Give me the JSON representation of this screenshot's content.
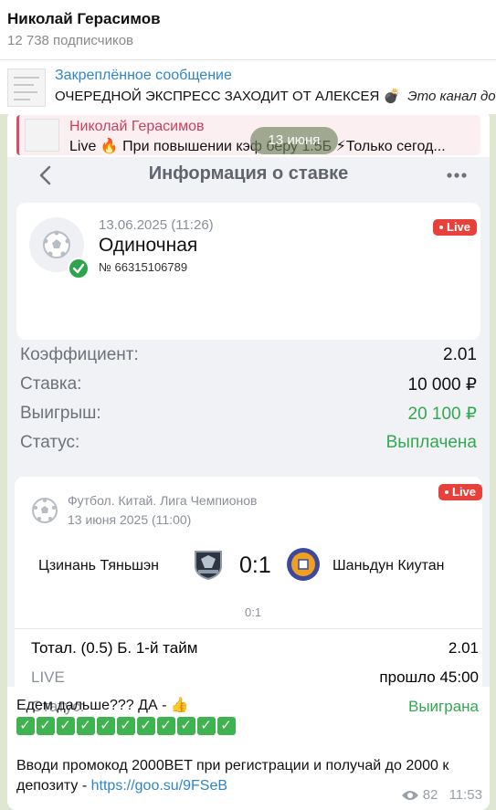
{
  "header": {
    "channel_name": "Николай Герасимов",
    "subscribers": "12 738 подписчиков"
  },
  "pinned": {
    "title": "Закреплённое сообщение",
    "text": "ОЧЕРЕДНОЙ ЭКСПРЕСС ЗАХОДИТ ОТ АЛЕКСЕЯ 💣",
    "text_italic": "Это канал до"
  },
  "reply": {
    "author": "Николай Герасимов",
    "text": "Live 🔥 При повышении кэф беру 1.5Б ⚡Только сегод..."
  },
  "date_pill": "13 июня",
  "bet_screen": {
    "title": "Информация о ставке",
    "live_label": "Live",
    "bet": {
      "date": "13.06.2025 (11:26)",
      "type": "Одиночная",
      "number": "№ 66315106789"
    },
    "rows": [
      {
        "key": "Коэффициент:",
        "value": "2.01"
      },
      {
        "key": "Ставка:",
        "value": "10 000 ₽"
      },
      {
        "key": "Выигрыш:",
        "value": "20 100 ₽"
      },
      {
        "key": "Статус:",
        "value": "Выплачена"
      }
    ],
    "match": {
      "league": "Футбол. Китай. Лига Чемпионов",
      "date": "13 июня 2025 (11:00)",
      "team1": "Цзинань Тяньшэн",
      "team2": "Шаньдун Киутан",
      "score": "0:1",
      "score_small": "0:1",
      "market": "Тотал. (0.5) Б. 1-й тайм",
      "odds": "2.01",
      "live": "LIVE",
      "elapsed": "прошло 45:00",
      "status_key": "Статус:",
      "status_value": "Выиграна"
    }
  },
  "caption": {
    "line1": "Едем дальше??? ДА - 👍",
    "checks_count": 11,
    "promo": "Вводи промокод 2000BET при регистрации и получай до 2000 к депозиту - ",
    "link": "https://goo.su/9FSeB"
  },
  "meta": {
    "views": "82",
    "time": "11:53"
  },
  "colors": {
    "accent": "#2f86c5",
    "green": "#33a852",
    "live": "#e8413c",
    "reply": "#c9415f"
  }
}
